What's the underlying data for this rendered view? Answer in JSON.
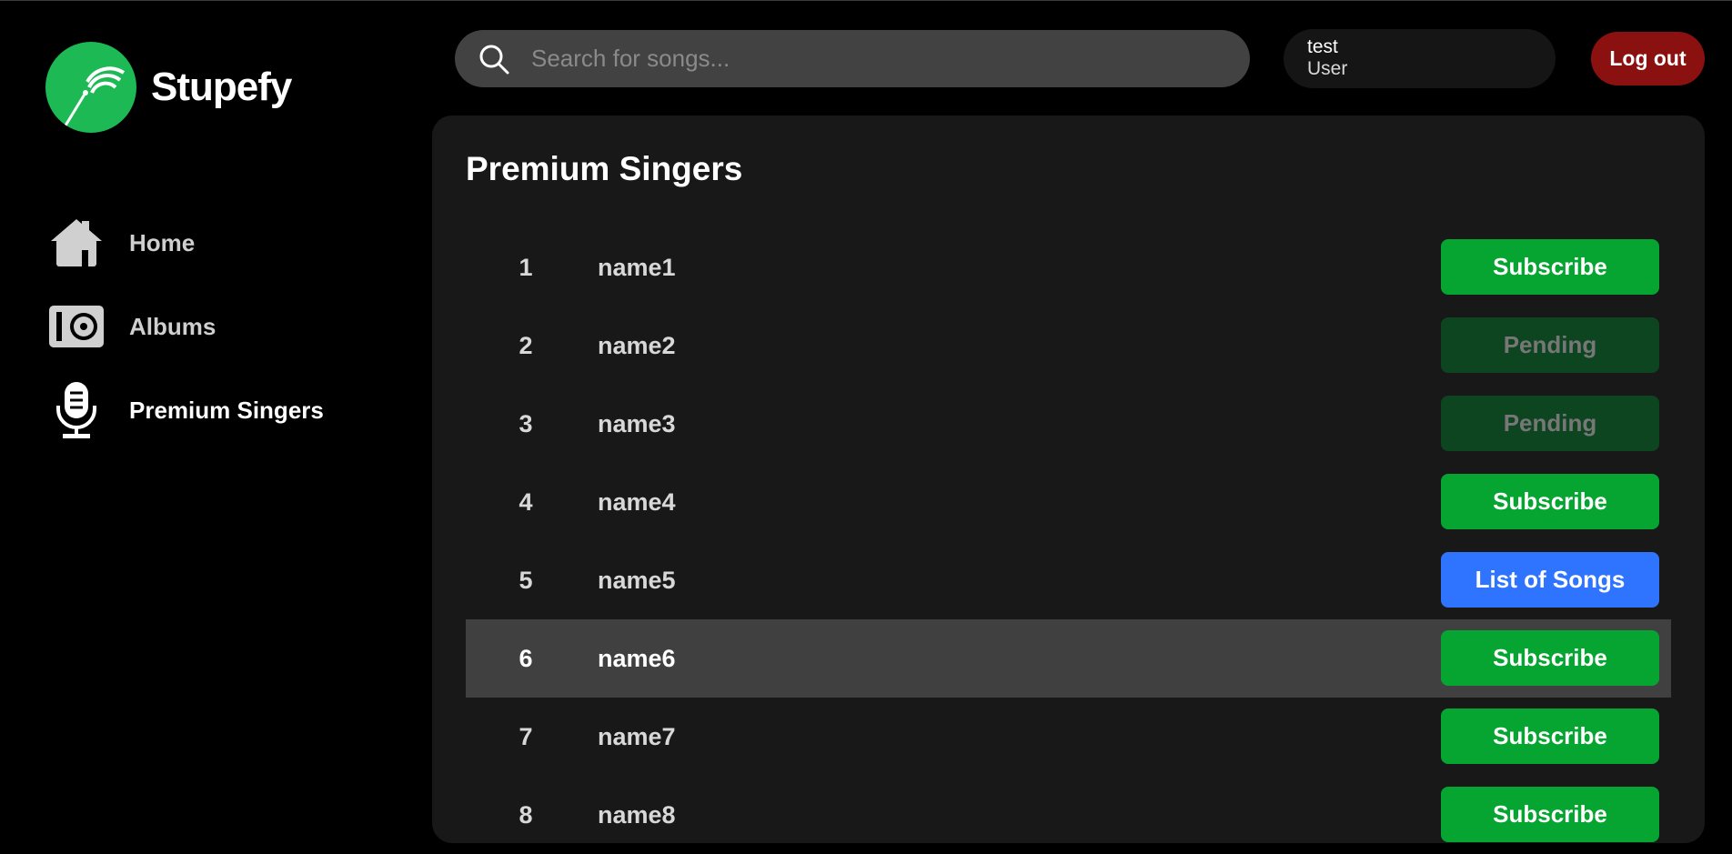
{
  "app": {
    "name": "Stupefy",
    "brand_color": "#1db954"
  },
  "sidebar": {
    "items": [
      {
        "label": "Home",
        "icon": "home-icon",
        "active": false
      },
      {
        "label": "Albums",
        "icon": "album-icon",
        "active": false
      },
      {
        "label": "Premium Singers",
        "icon": "microphone-icon",
        "active": true
      }
    ]
  },
  "search": {
    "placeholder": "Search for songs...",
    "value": ""
  },
  "user": {
    "name": "test",
    "role": "User"
  },
  "logout_label": "Log out",
  "page": {
    "title": "Premium Singers"
  },
  "singers": [
    {
      "num": "1",
      "name": "name1",
      "action": "Subscribe",
      "status": "subscribe"
    },
    {
      "num": "2",
      "name": "name2",
      "action": "Pending",
      "status": "pending"
    },
    {
      "num": "3",
      "name": "name3",
      "action": "Pending",
      "status": "pending"
    },
    {
      "num": "4",
      "name": "name4",
      "action": "Subscribe",
      "status": "subscribe"
    },
    {
      "num": "5",
      "name": "name5",
      "action": "List of Songs",
      "status": "list"
    },
    {
      "num": "6",
      "name": "name6",
      "action": "Subscribe",
      "status": "subscribe",
      "hover": true
    },
    {
      "num": "7",
      "name": "name7",
      "action": "Subscribe",
      "status": "subscribe"
    },
    {
      "num": "8",
      "name": "name8",
      "action": "Subscribe",
      "status": "subscribe"
    }
  ],
  "colors": {
    "subscribe": "#06a531",
    "pending": "#0e4521",
    "list": "#2e74ff",
    "logout": "#8b1111"
  }
}
